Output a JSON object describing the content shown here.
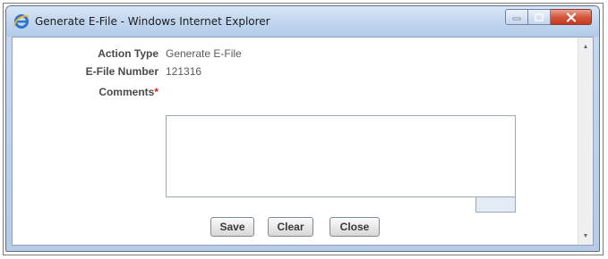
{
  "window": {
    "title": "Generate E-File - Windows Internet Explorer",
    "icon": "internet-explorer-icon",
    "caption_buttons": [
      "minimize-icon",
      "maximize-icon",
      "close-icon"
    ]
  },
  "form": {
    "action_type_label": "Action Type",
    "action_type_value": "Generate E-File",
    "efile_number_label": "E-File Number",
    "efile_number_value": "121316",
    "comments_label": "Comments",
    "comments_required_mark": "*",
    "comments_value": ""
  },
  "buttons": {
    "save": "Save",
    "clear": "Clear",
    "close": "Close"
  },
  "colors": {
    "required": "#d22020",
    "title_bar": "#c2d6ef",
    "close_button": "#d5573f"
  }
}
